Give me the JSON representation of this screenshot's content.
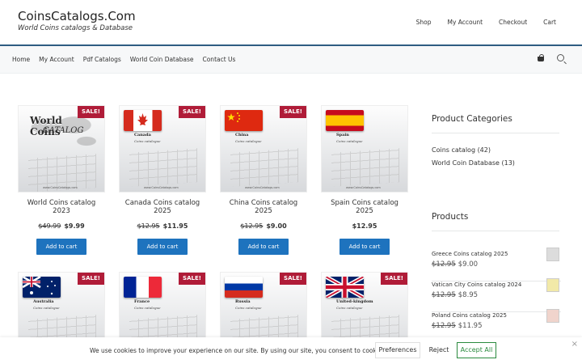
{
  "header": {
    "site_title": "CoinsCatalogs.Com",
    "tagline": "World Coins catalogs & Database",
    "top_links": [
      "Shop",
      "My Account",
      "Checkout",
      "Cart"
    ]
  },
  "nav": {
    "links": [
      "Home",
      "My Account",
      "Pdf Catalogs",
      "World Coin Database",
      "Contact Us"
    ]
  },
  "products": [
    {
      "title": "World Coins catalog 2023",
      "old_price": "$49.99",
      "price": "$9.99",
      "sale": "SALE!",
      "thumb_title": "World Coins",
      "thumb_sub": "CATALOG",
      "site": "www.CoinsCatalogs.com"
    },
    {
      "title": "Canada Coins catalog 2025",
      "old_price": "$12.95",
      "price": "$11.95",
      "sale": "SALE!",
      "country": "Canada",
      "sub": "Coins catalogue",
      "site": "www.CoinsCatalogs.com"
    },
    {
      "title": "China Coins catalog 2025",
      "old_price": "$12.95",
      "price": "$9.00",
      "sale": "SALE!",
      "country": "China",
      "sub": "Coins catalogue",
      "site": "www.CoinsCatalogs.com"
    },
    {
      "title": "Spain Coins catalog 2025",
      "old_price": "",
      "price": "$12.95",
      "sale": "",
      "country": "Spain",
      "sub": "Coins catalogue",
      "site": "www.CoinsCatalogs.com"
    },
    {
      "title": "",
      "sale": "SALE!",
      "country": "Australia",
      "sub": "Coins catalogue"
    },
    {
      "title": "",
      "sale": "SALE!",
      "country": "France",
      "sub": "Coins catalogue"
    },
    {
      "title": "",
      "sale": "SALE!",
      "country": "Russia",
      "sub": "Coins catalogue"
    },
    {
      "title": "",
      "sale": "SALE!",
      "country": "United-kingdom",
      "sub": "Coins catalogue"
    }
  ],
  "add_to_cart": "Add to cart",
  "sidebar": {
    "categories_heading": "Product Categories",
    "categories": [
      "Coins catalog (42)",
      "World Coin Database (13)"
    ],
    "products_heading": "Products",
    "products": [
      {
        "name": "Greece Coins catalog 2025",
        "old_price": "$12.95",
        "price": "$9.00"
      },
      {
        "name": "Vatican City Coins catalog 2024",
        "old_price": "$12.95",
        "price": "$8.95"
      },
      {
        "name": "Poland Coins catalog 2025",
        "old_price": "$12.95",
        "price": "$11.95"
      }
    ]
  },
  "cookie": {
    "message": "We use cookies to improve your experience on our site. By using our site, you consent to cookies.",
    "preferences": "Preferences",
    "reject": "Reject",
    "accept": "Accept All",
    "close": "×"
  }
}
